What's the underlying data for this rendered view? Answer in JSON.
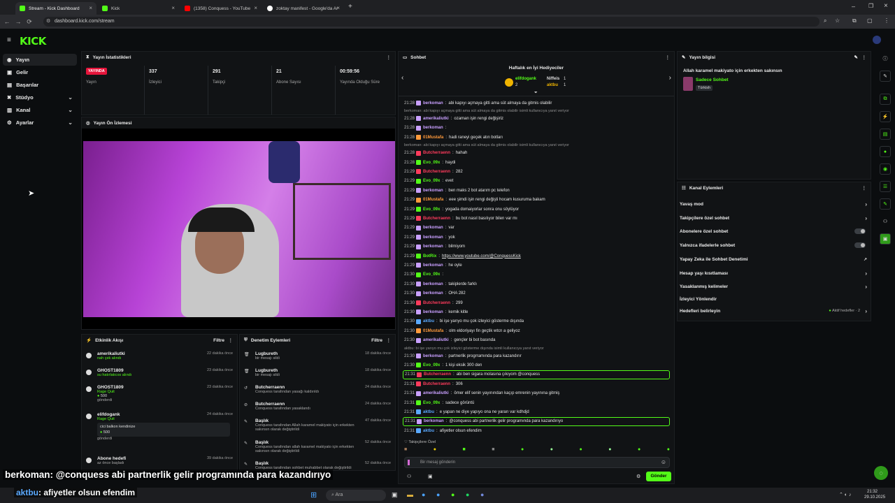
{
  "browser": {
    "tabs": [
      {
        "label": "Stream - Kick Dashboard",
        "color": "#53fc18"
      },
      {
        "label": "Kick",
        "color": "#53fc18"
      },
      {
        "label": "(1358) Conquess - YouTube",
        "color": "#ff0000"
      },
      {
        "label": "zoktay manifest - Google'da Ar",
        "color": "#ffffff"
      }
    ],
    "new_tab": "+",
    "url": "dashboard.kick.com/stream"
  },
  "app": {
    "logo": "KICK"
  },
  "sidebar": {
    "items": [
      {
        "label": "Yayın",
        "icon": "broadcast-icon"
      },
      {
        "label": "Gelir",
        "icon": "wallet-icon"
      },
      {
        "label": "Başarılar",
        "icon": "trophy-icon"
      },
      {
        "label": "Stüdyo",
        "icon": "studio-icon"
      },
      {
        "label": "Kanal",
        "icon": "channel-icon"
      },
      {
        "label": "Ayarlar",
        "icon": "gear-icon"
      }
    ]
  },
  "stats": {
    "title": "Yayın İstatistikleri",
    "live_badge": "YAYINDA",
    "cells": [
      {
        "value": "",
        "label": "Yayın"
      },
      {
        "value": "337",
        "label": "İzleyici"
      },
      {
        "value": "291",
        "label": "Takipçi"
      },
      {
        "value": "21",
        "label": "Abone Sayısı"
      },
      {
        "value": "00:59:56",
        "label": "Yayında Olduğu Süre"
      }
    ]
  },
  "preview": {
    "title": "Yayın Ön İzlemesi"
  },
  "activity": {
    "title": "Etkinlik Akışı",
    "filter": "Filtre",
    "items": [
      {
        "name": "amerikaliutki",
        "sub": "nah çek alındı",
        "time": "22 dakika önce"
      },
      {
        "name": "GHOST1809",
        "sub": "su hatırlatıcısı alındı",
        "time": "23 dakika önce"
      },
      {
        "name": "GHOST1809",
        "sub": "Rage Quit",
        "amount": "500",
        "sub2": "gönderdi",
        "time": "23 dakika önce"
      },
      {
        "name": "elifdogank",
        "sub": "Rage Quit",
        "note": "cici balkon kendinize",
        "amount": "500",
        "sub2": "gönderdi",
        "time": "24 dakika önce"
      },
      {
        "name": "Abone hedefi",
        "sub": "az önce başladı",
        "time": "39 dakika önce"
      }
    ]
  },
  "moderation": {
    "title": "Denetim Eylemleri",
    "filter": "Filtre",
    "items": [
      {
        "name": "Lugbureth",
        "sub": "bir mesajı sildi",
        "time": "18 dakika önce"
      },
      {
        "name": "Lugbureth",
        "sub": "bir mesajı sildi",
        "time": "18 dakika önce"
      },
      {
        "name": "Butcherraenn",
        "sub": "Conquess tarafından yasağı kaldırıldı",
        "time": "24 dakika önce"
      },
      {
        "name": "Butcherraenn",
        "sub": "Conquess tarafından yasaklandı",
        "time": "24 dakika önce"
      },
      {
        "name": "Başlık",
        "sub": "Conquess tarafından Allah karamel makiyato için erkekten sakınsın olarak değiştirildi",
        "time": "47 dakika önce"
      },
      {
        "name": "Başlık",
        "sub": "Conquess tarafından allah karamel makiyato için erkekten sakınsın olarak değiştirildi",
        "time": "52 dakika önce"
      },
      {
        "name": "Başlık",
        "sub": "Conquess tarafından sohbet muhabbet olarak değiştirildi",
        "time": "52 dakika önce"
      }
    ]
  },
  "chat": {
    "title": "Sohbet",
    "gifters_title": "Haftalık en İyi Hediyeciler",
    "gifters": [
      {
        "name": "elifdogank",
        "count": "2"
      },
      {
        "name": "Niffeis",
        "count": "1"
      },
      {
        "name": "aktbu",
        "count": "1"
      }
    ],
    "messages": [
      {
        "time": "21:28",
        "user": "berkoman",
        "color": "#c9a0ff",
        "text": "abi kapıyı açmaya gitti ama süt almaya da gitmis olabilir"
      },
      {
        "reply": "berkoman: abi kapıyı açmaya gitti ama süt almaya da gitmis olabilir isimli kullanıcıya yanıt veriyor"
      },
      {
        "time": "21:28",
        "user": "amerikaliutki",
        "color": "#c9a0ff",
        "text": "ozaman işin rengi değişiriz"
      },
      {
        "time": "21:28",
        "user": "berkoman",
        "color": "#c9a0ff",
        "text": ""
      },
      {
        "time": "21:28",
        "user": "01Mustafa",
        "color": "#ff9a3c",
        "text": "hadi raneyi geçek atın botları"
      },
      {
        "reply": "berkoman: abi kapıyı açmaya gitti ama süt almaya da gitmis olabilir isimli kullanıcıya yanıt veriyor"
      },
      {
        "time": "21:28",
        "user": "Butcherraenn",
        "color": "#ff3b5c",
        "text": "hahah"
      },
      {
        "time": "21:28",
        "user": "Evo_09x",
        "color": "#53fc18",
        "text": "haydi"
      },
      {
        "time": "21:29",
        "user": "Butcherraenn",
        "color": "#ff3b5c",
        "text": "282"
      },
      {
        "time": "21:29",
        "user": "Evo_09x",
        "color": "#53fc18",
        "text": "evet"
      },
      {
        "time": "21:29",
        "user": "berkoman",
        "color": "#c9a0ff",
        "text": "ben maks 2 bot atarım pc telefon"
      },
      {
        "time": "21:29",
        "user": "01Mustafa",
        "color": "#ff9a3c",
        "text": "eee şimdi işin rengi değişti hocam kusuruma bakam"
      },
      {
        "time": "21:29",
        "user": "Evo_09x",
        "color": "#53fc18",
        "text": "yogada domaiyorlar sonra onu söylüyor"
      },
      {
        "time": "21:29",
        "user": "Butcherraenn",
        "color": "#ff3b5c",
        "text": "bu bot nasıl basılıyor bilen var mı"
      },
      {
        "time": "21:29",
        "user": "berkoman",
        "color": "#c9a0ff",
        "text": "var"
      },
      {
        "time": "21:29",
        "user": "berkoman",
        "color": "#c9a0ff",
        "text": "yok"
      },
      {
        "time": "21:29",
        "user": "berkoman",
        "color": "#c9a0ff",
        "text": "bilmiyom"
      },
      {
        "time": "21:29",
        "user": "BotRix",
        "color": "#53fc18",
        "text": "https://www.youtube.com/@ConquessKick"
      },
      {
        "time": "21:29",
        "user": "berkoman",
        "color": "#c9a0ff",
        "text": "he oyle"
      },
      {
        "time": "21:30",
        "user": "Evo_09x",
        "color": "#53fc18",
        "text": ""
      },
      {
        "time": "21:30",
        "user": "berkoman",
        "color": "#c9a0ff",
        "text": "takiplerde farklı"
      },
      {
        "time": "21:30",
        "user": "berkoman",
        "color": "#c9a0ff",
        "text": "OHA 282"
      },
      {
        "time": "21:30",
        "user": "Butcherraenn",
        "color": "#ff3b5c",
        "text": "299"
      },
      {
        "time": "21:30",
        "user": "berkoman",
        "color": "#c9a0ff",
        "text": "kemik kitle"
      },
      {
        "time": "21:30",
        "user": "aktbu",
        "color": "#5aa9ff",
        "text": "bi işe yarıyo mu çok izleyici gösterme dışında"
      },
      {
        "time": "21:30",
        "user": "01Mustafa",
        "color": "#ff9a3c",
        "text": "olm eldoriyayı fin geçtik wtcn a geliyoz"
      },
      {
        "time": "21:30",
        "user": "amerikaliutki",
        "color": "#c9a0ff",
        "text": "gençler bi bot basında"
      },
      {
        "reply": "aktbu: bi işe yarıyo mu çok izleyici gösterme dışında isimli kullanıcıya yanıt veriyor"
      },
      {
        "time": "21:30",
        "user": "berkoman",
        "color": "#c9a0ff",
        "text": "partnerlik progrramında para kazandırır"
      },
      {
        "time": "21:30",
        "user": "Evo_09x",
        "color": "#53fc18",
        "text": "1 kişi eksik 300 den"
      },
      {
        "time": "21:31",
        "user": "Butcherraenn",
        "color": "#ff3b5c",
        "text": "abi ben sigara molasına çıkıyom @conquess",
        "hl": true
      },
      {
        "time": "21:31",
        "user": "Butcherraenn",
        "color": "#ff3b5c",
        "text": "306"
      },
      {
        "time": "21:31",
        "user": "amerikaliutki",
        "color": "#c9a0ff",
        "text": "ömer elif senin yayınından kaçıp emrenin yayınına gitmiş"
      },
      {
        "time": "21:31",
        "user": "Evo_09x",
        "color": "#53fc18",
        "text": "sadece görüntü"
      },
      {
        "time": "21:31",
        "user": "aktbu",
        "color": "#5aa9ff",
        "text": "e yapan ne diye yapıyo ona ne yararı var kdhdjd"
      },
      {
        "time": "21:31",
        "user": "berkoman",
        "color": "#c9a0ff",
        "text": "@conquess abi partnerlik gelir programında para kazandırıyo",
        "hl": true
      },
      {
        "time": "21:31",
        "user": "aktbu",
        "color": "#5aa9ff",
        "text": "afiyetler olsun efendim"
      }
    ],
    "followers_only": "Takipçilere Özel",
    "input_placeholder": "Bir mesaj gönderin",
    "send": "Gönder"
  },
  "stream_info": {
    "title": "Yayın bilgisi",
    "stream_title": "Allah karamel makiyato için erkekten sakınsın",
    "category": "Sadece Sohbet",
    "language": "Türkish"
  },
  "channel_actions": {
    "title": "Kanal Eylemleri",
    "items": [
      {
        "label": "Yavaş mod",
        "kind": "chevron"
      },
      {
        "label": "Takipçilere özel sohbet",
        "kind": "chevron"
      },
      {
        "label": "Abonelere özel sohbet",
        "kind": "toggle"
      },
      {
        "label": "Yalnızca ifadelerle sohbet",
        "kind": "toggle"
      },
      {
        "label": "Yapay Zeka ile Sohbet Denetimi",
        "kind": "external"
      },
      {
        "label": "Hesap yaşı kısıtlaması",
        "kind": "chevron"
      },
      {
        "label": "Yasaklanmış kelimeler",
        "kind": "chevron"
      },
      {
        "label": "İzleyici Yönlendir",
        "kind": "none"
      },
      {
        "label": "Hedefleri belirleyin",
        "kind": "chevron",
        "extra": "Aktif hedefler · 2"
      }
    ]
  },
  "subtitles": [
    {
      "name": "berkoman",
      "text": ": @conquess abi partnerlik gelir programında para kazandırıyo"
    },
    {
      "name": "aktbu",
      "text": ": afiyetler olsun efendim"
    }
  ],
  "taskbar": {
    "search": "Ara",
    "time": "21:32",
    "date": "29.10.2025"
  }
}
